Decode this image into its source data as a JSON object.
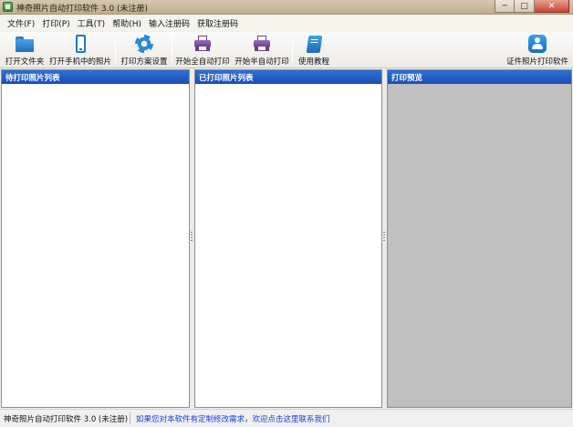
{
  "window": {
    "title": "神奇照片自动打印软件 3.0 (未注册)",
    "minimize_glyph": "─",
    "maximize_glyph": "□",
    "close_glyph": "✕"
  },
  "menu": [
    {
      "label": "文件(F)"
    },
    {
      "label": "打印(P)"
    },
    {
      "label": "工具(T)"
    },
    {
      "label": "帮助(H)"
    },
    {
      "label": "输入注册码"
    },
    {
      "label": "获取注册码"
    }
  ],
  "toolbar": {
    "open_folder": {
      "label": "打开文件夹",
      "icon": "folder-icon"
    },
    "open_phone": {
      "label": "打开手机中的照片",
      "icon": "phone-icon"
    },
    "print_settings": {
      "label": "打印方案设置",
      "icon": "gear-icon"
    },
    "auto_print": {
      "label": "开始全自动打印",
      "icon": "printer-icon"
    },
    "semi_auto_print": {
      "label": "开始半自动打印",
      "icon": "printer-icon"
    },
    "tutorial": {
      "label": "使用教程",
      "icon": "book-icon"
    },
    "id_photo": {
      "label": "证件照片打印软件",
      "icon": "id-photo-icon"
    }
  },
  "panels": {
    "pending": {
      "title": "待打印照片列表"
    },
    "printed": {
      "title": "已打印照片列表"
    },
    "preview": {
      "title": "打印预览"
    }
  },
  "status": {
    "left": "神奇照片自动打印软件 3.0 (未注册)",
    "link": "如果您对本软件有定制修改需求，欢迎点击这里联系我们"
  },
  "colors": {
    "panel_header": "#1f5bc2",
    "preview_bg": "#c0c0c0",
    "link": "#1a3cd6"
  }
}
